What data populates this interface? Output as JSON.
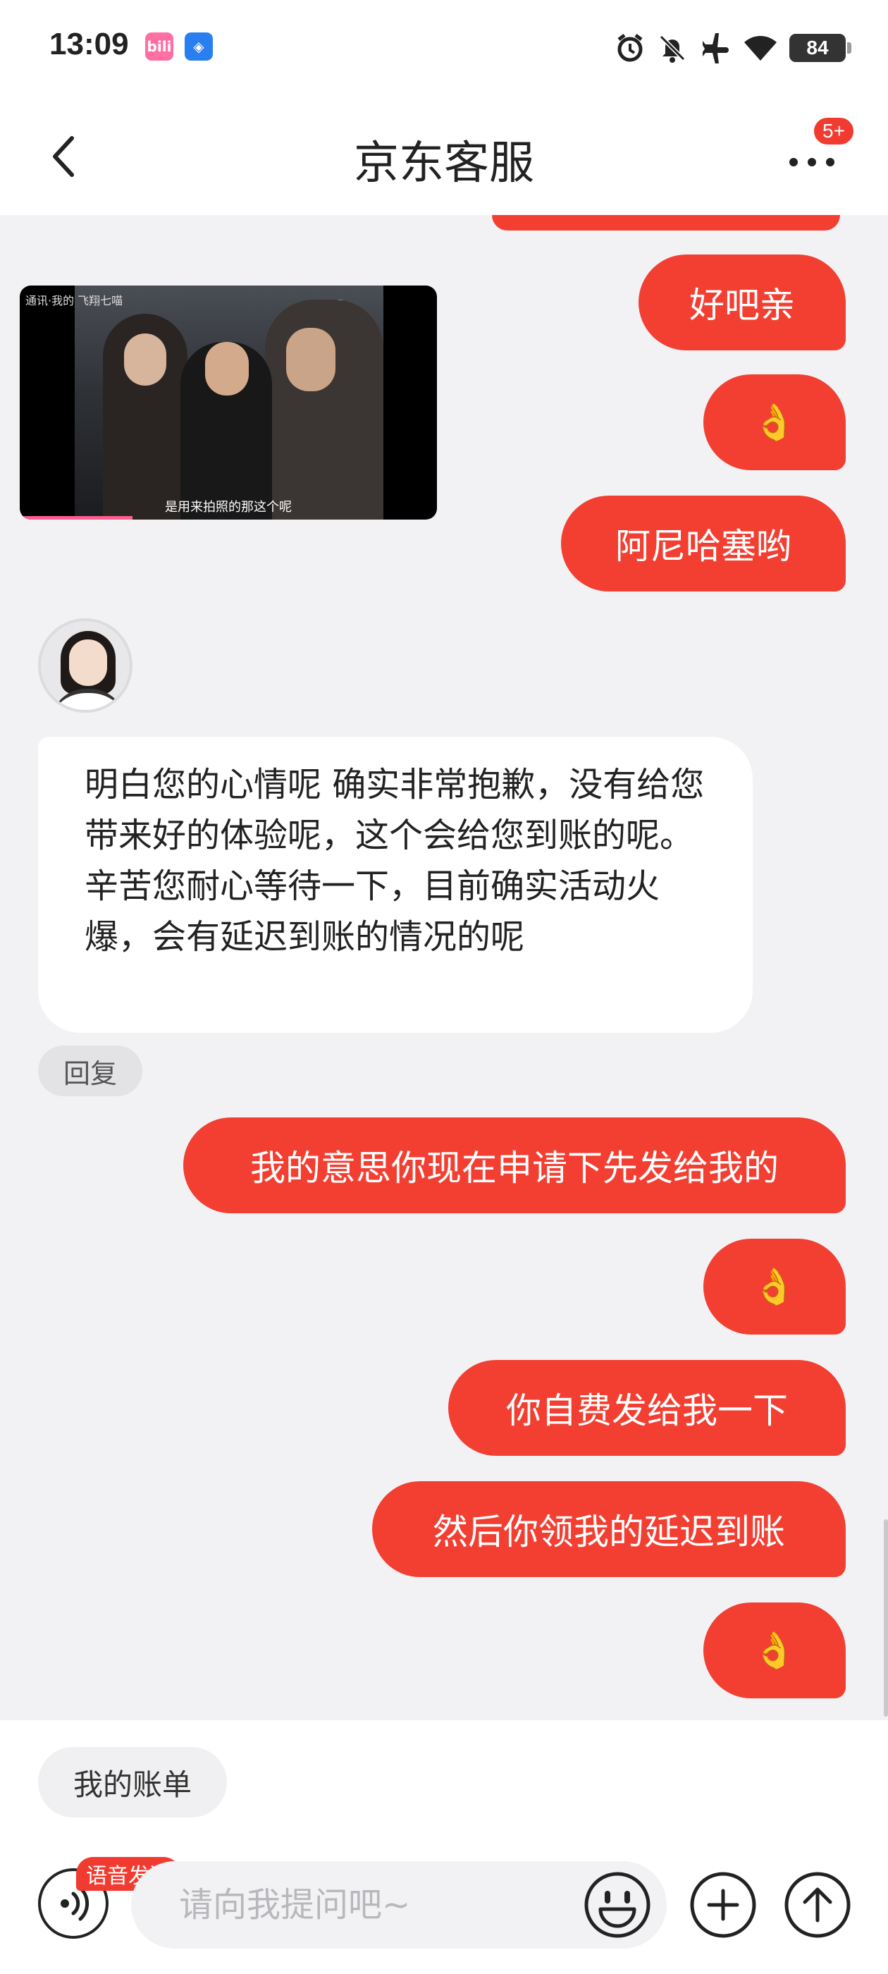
{
  "status_bar": {
    "time": "13:09",
    "battery": "84",
    "icons": [
      "bilibili-app-icon",
      "message-app-icon",
      "alarm-icon",
      "mute-icon",
      "airplane-icon",
      "wifi-icon"
    ]
  },
  "header": {
    "title": "京东客服",
    "badge": "5+"
  },
  "chat": {
    "messages": [
      {
        "side": "right",
        "text": "好吧亲"
      },
      {
        "side": "right",
        "type": "emoji",
        "text": "👌"
      },
      {
        "side": "right",
        "text": "阿尼哈塞哟"
      },
      {
        "side": "left",
        "text": "明白您的心情呢 确实非常抱歉，没有给您带来好的体验呢，这个会给您到账的呢。辛苦您耐心等待一下，目前确实活动火爆，会有延迟到账的情况的呢"
      },
      {
        "side": "right",
        "text": "我的意思你现在申请下先发给我的"
      },
      {
        "side": "right",
        "type": "emoji",
        "text": "👌"
      },
      {
        "side": "right",
        "text": "你自费发给我一下"
      },
      {
        "side": "right",
        "text": "然后你领我的延迟到账"
      },
      {
        "side": "right",
        "type": "emoji",
        "text": "👌"
      }
    ],
    "video": {
      "subtitle": "是用来拍照的那这个呢",
      "corner_tag": "通讯·我的 飞翔七喵"
    },
    "reply_label": "回复"
  },
  "bottom": {
    "quick_reply": "我的账单",
    "voice_tag": "语音发送",
    "input_placeholder": "请向我提问吧~"
  },
  "colors": {
    "accent": "#f23f32",
    "background": "#f2f2f4"
  }
}
